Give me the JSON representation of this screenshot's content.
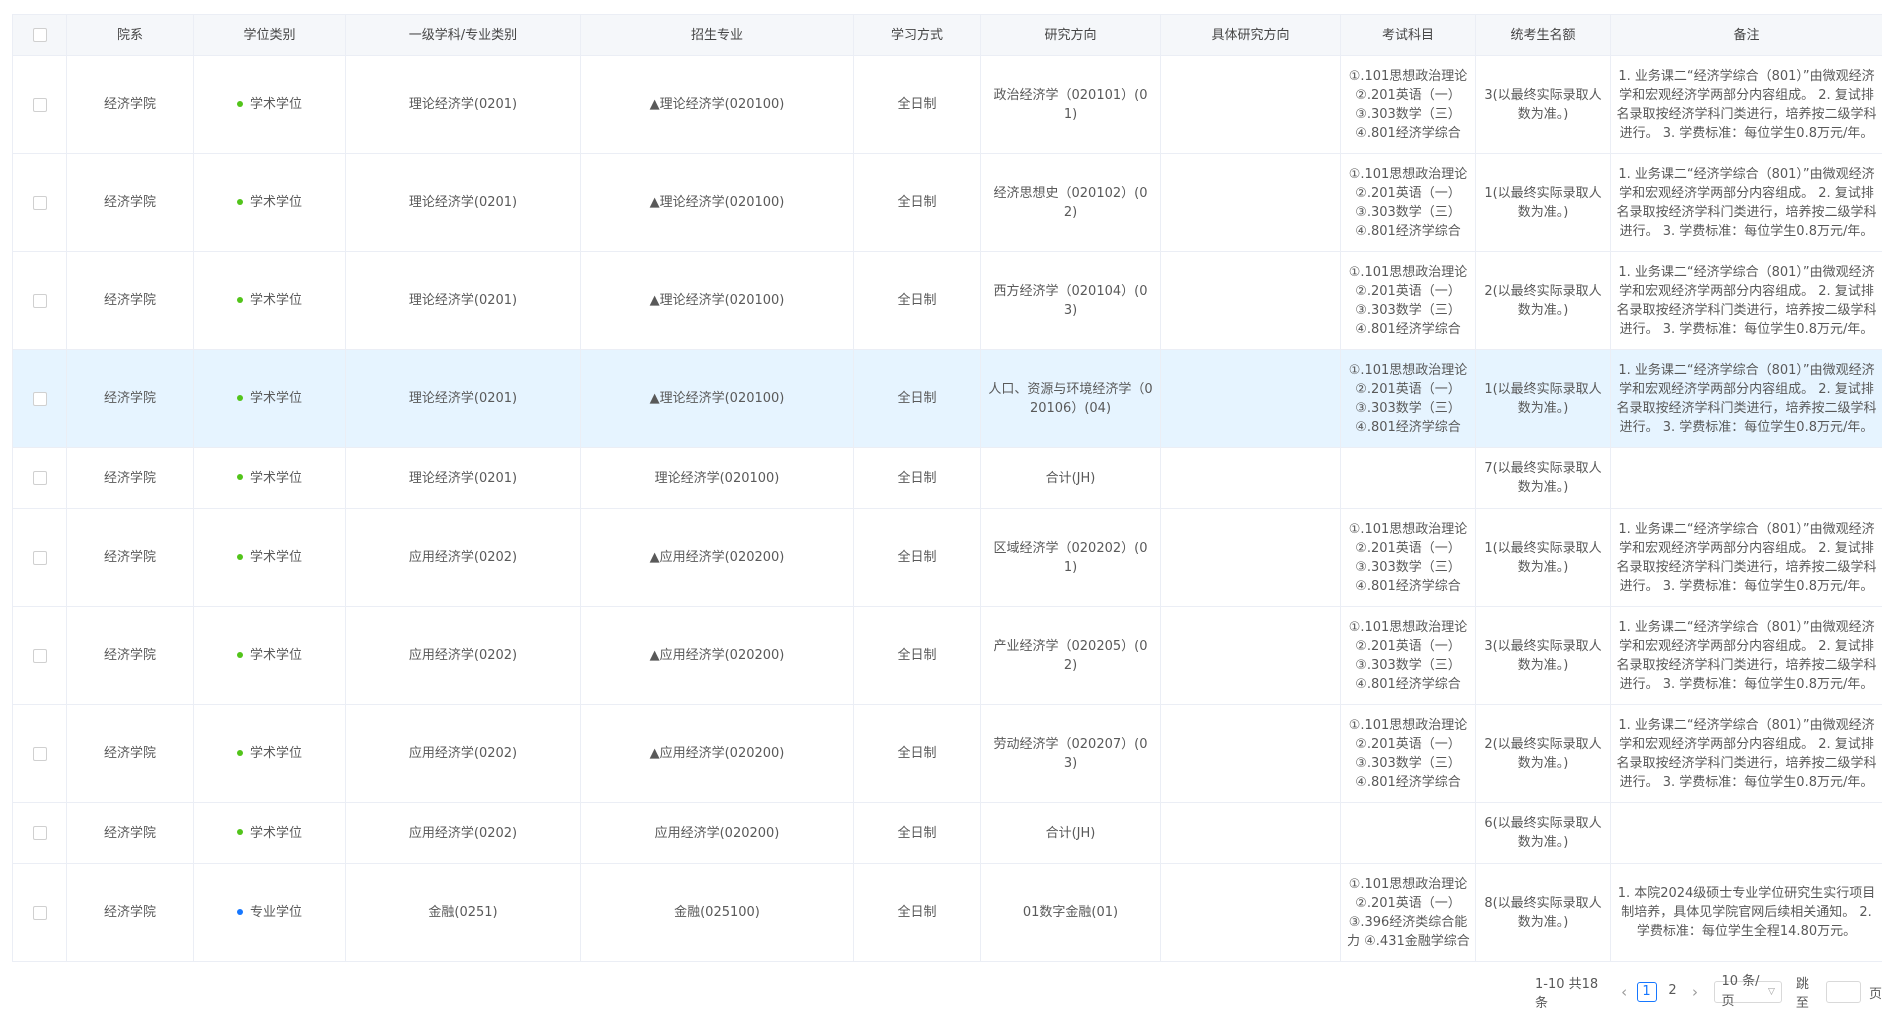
{
  "columns": [
    "院系",
    "学位类别",
    "一级学科/专业类别",
    "招生专业",
    "学习方式",
    "研究方向",
    "具体研究方向",
    "考试科目",
    "统考生名额",
    "备注"
  ],
  "colors": {
    "academic_dot": "#52c41a",
    "professional_dot": "#1677ff",
    "highlight_row": "#e6f4ff",
    "accent": "#1677ff"
  },
  "rows": [
    {
      "dept": "经济学院",
      "degree": "学术学位",
      "degree_type": "academic",
      "discipline": "理论经济学(0201)",
      "major": "▲理论经济学(020100)",
      "mode": "全日制",
      "direction": "政治经济学（020101）(01)",
      "specific": "",
      "exam": [
        "①.101思想政治理论",
        "②.201英语（一）",
        "③.303数学（三）",
        "④.801经济学综合"
      ],
      "quota": "3(以最终实际录取人数为准。)",
      "remark": "1. 业务课二“经济学综合（801）”由微观经济学和宏观经济学两部分内容组成。 2. 复试排名录取按经济学科门类进行，培养按二级学科进行。 3. 学费标准：每位学生0.8万元/年。"
    },
    {
      "dept": "经济学院",
      "degree": "学术学位",
      "degree_type": "academic",
      "discipline": "理论经济学(0201)",
      "major": "▲理论经济学(020100)",
      "mode": "全日制",
      "direction": "经济思想史（020102）(02)",
      "specific": "",
      "exam": [
        "①.101思想政治理论",
        "②.201英语（一）",
        "③.303数学（三）",
        "④.801经济学综合"
      ],
      "quota": "1(以最终实际录取人数为准。)",
      "remark": "1. 业务课二“经济学综合（801）”由微观经济学和宏观经济学两部分内容组成。 2. 复试排名录取按经济学科门类进行，培养按二级学科进行。 3. 学费标准：每位学生0.8万元/年。"
    },
    {
      "dept": "经济学院",
      "degree": "学术学位",
      "degree_type": "academic",
      "discipline": "理论经济学(0201)",
      "major": "▲理论经济学(020100)",
      "mode": "全日制",
      "direction": "西方经济学（020104）(03)",
      "specific": "",
      "exam": [
        "①.101思想政治理论",
        "②.201英语（一）",
        "③.303数学（三）",
        "④.801经济学综合"
      ],
      "quota": "2(以最终实际录取人数为准。)",
      "remark": "1. 业务课二“经济学综合（801）”由微观经济学和宏观经济学两部分内容组成。 2. 复试排名录取按经济学科门类进行，培养按二级学科进行。 3. 学费标准：每位学生0.8万元/年。"
    },
    {
      "dept": "经济学院",
      "degree": "学术学位",
      "degree_type": "academic",
      "discipline": "理论经济学(0201)",
      "major": "▲理论经济学(020100)",
      "mode": "全日制",
      "direction": "人口、资源与环境经济学（020106）(04)",
      "specific": "",
      "exam": [
        "①.101思想政治理论",
        "②.201英语（一）",
        "③.303数学（三）",
        "④.801经济学综合"
      ],
      "quota": "1(以最终实际录取人数为准。)",
      "remark": "1. 业务课二“经济学综合（801）”由微观经济学和宏观经济学两部分内容组成。 2. 复试排名录取按经济学科门类进行，培养按二级学科进行。 3. 学费标准：每位学生0.8万元/年。",
      "highlight": true
    },
    {
      "dept": "经济学院",
      "degree": "学术学位",
      "degree_type": "academic",
      "discipline": "理论经济学(0201)",
      "major": "理论经济学(020100)",
      "mode": "全日制",
      "direction": "合计(JH)",
      "specific": "",
      "exam": [],
      "quota": "7(以最终实际录取人数为准。)",
      "remark": "",
      "short": true
    },
    {
      "dept": "经济学院",
      "degree": "学术学位",
      "degree_type": "academic",
      "discipline": "应用经济学(0202)",
      "major": "▲应用经济学(020200)",
      "mode": "全日制",
      "direction": "区域经济学（020202）(01)",
      "specific": "",
      "exam": [
        "①.101思想政治理论",
        "②.201英语（一）",
        "③.303数学（三）",
        "④.801经济学综合"
      ],
      "quota": "1(以最终实际录取人数为准。)",
      "remark": "1. 业务课二“经济学综合（801）”由微观经济学和宏观经济学两部分内容组成。 2. 复试排名录取按经济学科门类进行，培养按二级学科进行。 3. 学费标准：每位学生0.8万元/年。"
    },
    {
      "dept": "经济学院",
      "degree": "学术学位",
      "degree_type": "academic",
      "discipline": "应用经济学(0202)",
      "major": "▲应用经济学(020200)",
      "mode": "全日制",
      "direction": "产业经济学（020205）(02)",
      "specific": "",
      "exam": [
        "①.101思想政治理论",
        "②.201英语（一）",
        "③.303数学（三）",
        "④.801经济学综合"
      ],
      "quota": "3(以最终实际录取人数为准。)",
      "remark": "1. 业务课二“经济学综合（801）”由微观经济学和宏观经济学两部分内容组成。 2. 复试排名录取按经济学科门类进行，培养按二级学科进行。 3. 学费标准：每位学生0.8万元/年。"
    },
    {
      "dept": "经济学院",
      "degree": "学术学位",
      "degree_type": "academic",
      "discipline": "应用经济学(0202)",
      "major": "▲应用经济学(020200)",
      "mode": "全日制",
      "direction": "劳动经济学（020207）(03)",
      "specific": "",
      "exam": [
        "①.101思想政治理论",
        "②.201英语（一）",
        "③.303数学（三）",
        "④.801经济学综合"
      ],
      "quota": "2(以最终实际录取人数为准。)",
      "remark": "1. 业务课二“经济学综合（801）”由微观经济学和宏观经济学两部分内容组成。 2. 复试排名录取按经济学科门类进行，培养按二级学科进行。 3. 学费标准：每位学生0.8万元/年。"
    },
    {
      "dept": "经济学院",
      "degree": "学术学位",
      "degree_type": "academic",
      "discipline": "应用经济学(0202)",
      "major": "应用经济学(020200)",
      "mode": "全日制",
      "direction": "合计(JH)",
      "specific": "",
      "exam": [],
      "quota": "6(以最终实际录取人数为准。)",
      "remark": "",
      "short": true
    },
    {
      "dept": "经济学院",
      "degree": "专业学位",
      "degree_type": "professional",
      "discipline": "金融(0251)",
      "major": "金融(025100)",
      "mode": "全日制",
      "direction": "01数字金融(01)",
      "specific": "",
      "exam": [
        "①.101思想政治理论",
        "②.201英语（一）",
        "③.396经济类综合能",
        "力 ④.431金融学综合"
      ],
      "quota": "8(以最终实际录取人数为准。)",
      "remark": "1. 本院2024级硕士专业学位研究生实行项目制培养，具体见学院官网后续相关通知。 2. 学费标准：每位学生全程14.80万元。"
    }
  ],
  "pagination": {
    "total_text": "1-10 共18条",
    "prev": "‹",
    "pages": [
      "1",
      "2"
    ],
    "current": "1",
    "next": "›",
    "page_size": "10 条/页",
    "jump_label": "跳至",
    "jump_suffix": "页"
  }
}
